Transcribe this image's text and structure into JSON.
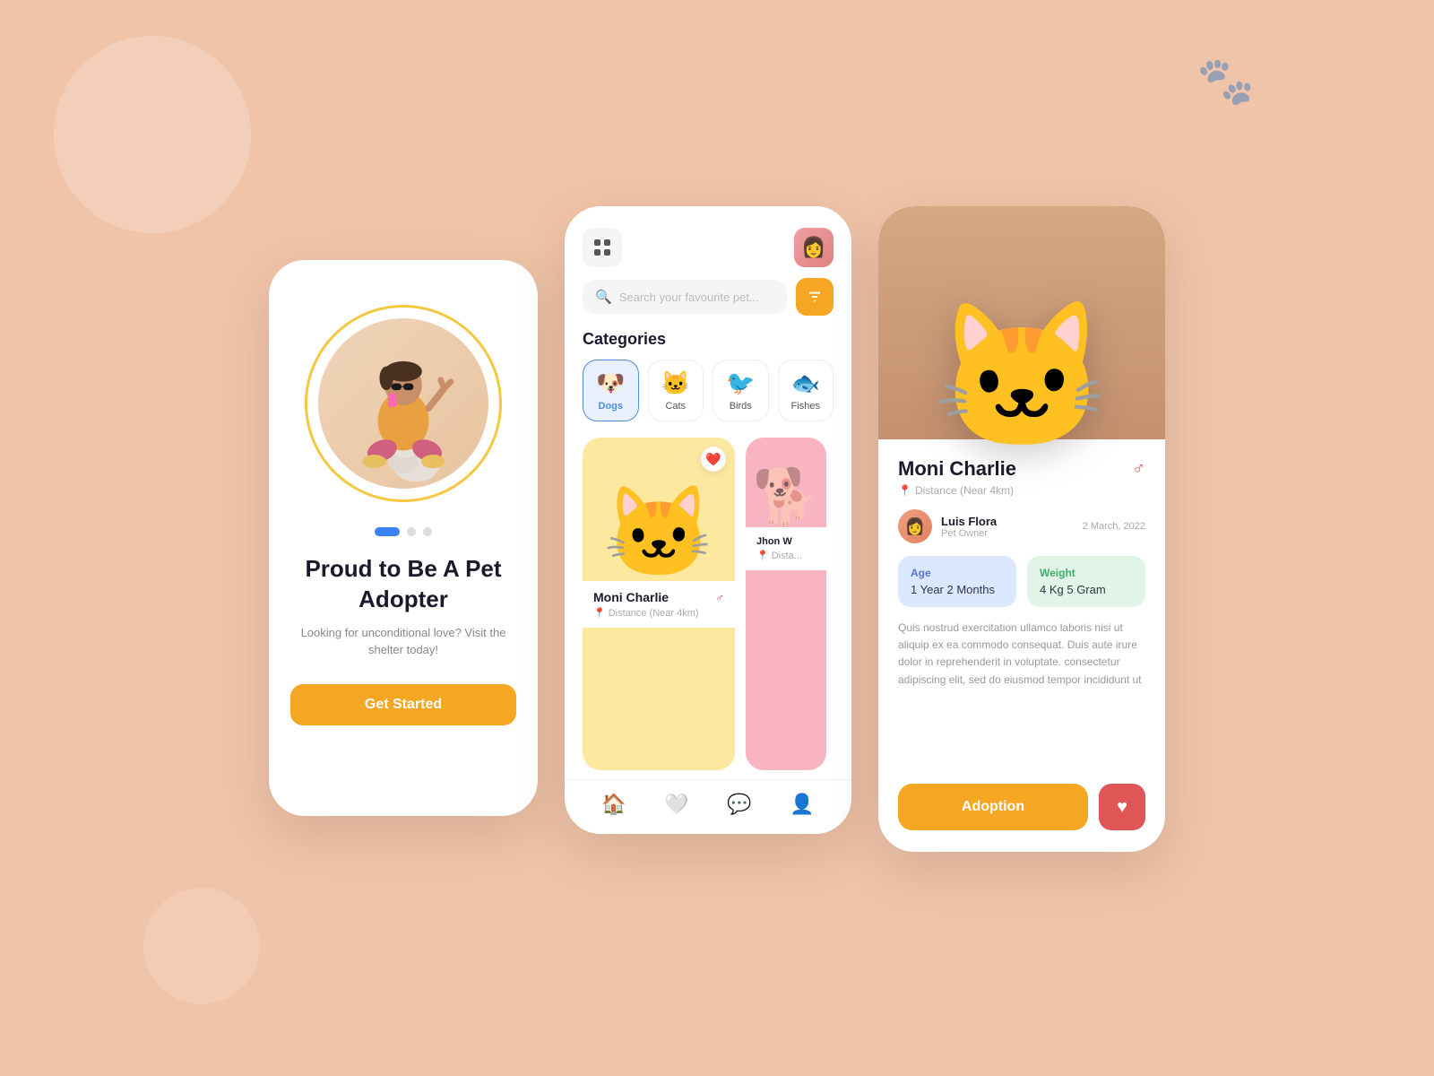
{
  "bg": {
    "paw_icon": "🐾"
  },
  "phone1": {
    "title": "Proud to Be A\nPet Adopter",
    "subtitle": "Looking for unconditional love? Visit\nthe shelter today!",
    "cta_label": "Get Started",
    "dots": [
      true,
      false,
      false
    ]
  },
  "phone2": {
    "search_placeholder": "Search your favourite pet...",
    "categories_title": "Categories",
    "categories": [
      {
        "emoji": "🐶",
        "label": "Dogs",
        "active": true
      },
      {
        "emoji": "🐱",
        "label": "Cats",
        "active": false
      },
      {
        "emoji": "🐦",
        "label": "Birds",
        "active": false
      },
      {
        "emoji": "🐟",
        "label": "Fishes",
        "active": false
      }
    ],
    "pet_cards": [
      {
        "name": "Moni Charlie",
        "distance": "Distance (Near 4km)",
        "gender": "♂",
        "bg": "#fde8a0"
      },
      {
        "name": "Jhon W",
        "distance": "Dista...",
        "gender": "♂",
        "bg": "#f8b4c0"
      }
    ],
    "nav_items": [
      "home",
      "heart",
      "chat",
      "profile"
    ]
  },
  "phone3": {
    "pet_name": "Moni Charlie",
    "gender": "♂",
    "distance": "Distance (Near 4km)",
    "owner": {
      "name": "Luis Flora",
      "role": "Pet Owner",
      "date": "2 March, 2022"
    },
    "stats": {
      "age_label": "Age",
      "age_value": "1 Year 2 Months",
      "weight_label": "Weight",
      "weight_value": "4 Kg 5 Gram"
    },
    "description": "Quis nostrud exercitation ullamco laboris nisi ut aliquip ex ea commodo consequat. Duis aute irure dolor in reprehenderit in voluptate. consectetur adipiscing elit, sed do eiusmod tempor incididunt ut",
    "adoption_label": "Adoption",
    "heart_icon": "♥"
  }
}
